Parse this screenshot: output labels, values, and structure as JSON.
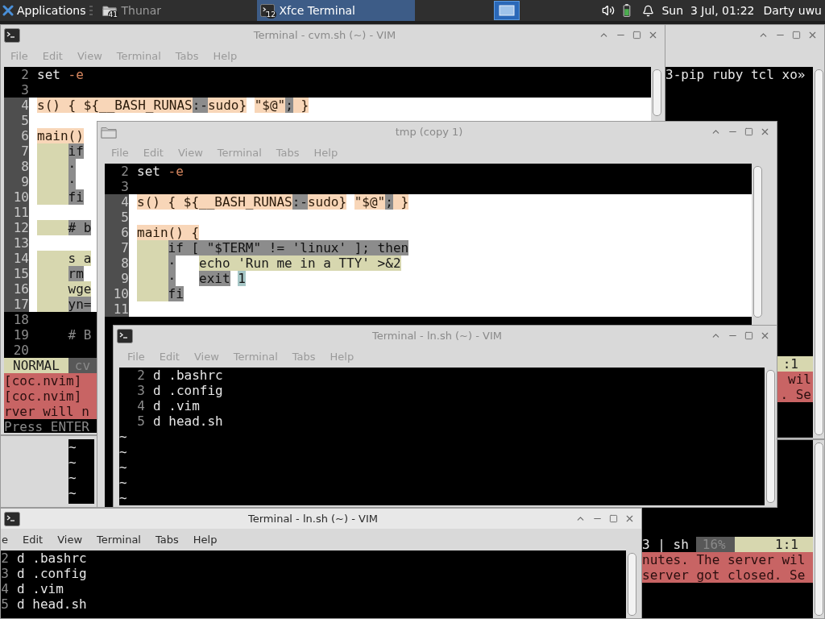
{
  "taskbar": {
    "menu": "Applications",
    "tasks": [
      {
        "label": "Thunar",
        "count": "41",
        "selected": false
      },
      {
        "label": "Xfce Terminal",
        "count": "12",
        "selected": true
      }
    ],
    "clock": "Sun  3 Jul, 01:22",
    "user": "Darty uwu"
  },
  "windows": [
    {
      "lines": [
        {
          "kind": "dark",
          "segments": [
            {
              "text": "3-pip ruby tcl xo»",
              "kind": "plain"
            }
          ]
        }
      ],
      "status": [
        {
          "text": ":1",
          "kind": "olive"
        }
      ],
      "messages": [
        "wil",
        ". Se"
      ]
    },
    {
      "status": [
        {
          "text": "3 | sh",
          "kind": "plain"
        },
        {
          "text": "16%",
          "kind": "muted"
        },
        {
          "text": "1:1",
          "kind": "olive"
        }
      ],
      "messages": [
        "nutes. The server wil",
        "server got closed. Se"
      ]
    },
    {
      "title": "Terminal - cvm.sh (~) - VIM",
      "active": false,
      "menu": [
        "File",
        "Edit",
        "View",
        "Terminal",
        "Tabs",
        "Help"
      ],
      "lines": [
        {
          "num": "2",
          "kind": "dark",
          "segments": [
            {
              "text": "set",
              "kind": "plain"
            },
            {
              "kind": "space"
            },
            {
              "text": "-e",
              "kind": "red"
            }
          ]
        },
        {
          "num": "3",
          "kind": "dark"
        },
        {
          "num": "4",
          "kind": "lit",
          "segments": [
            {
              "text": "s() { ${__BASH_RUNAS",
              "kind": "peach"
            },
            {
              "text": ":-",
              "kind": "gray"
            },
            {
              "text": "sudo}",
              "kind": "peach"
            },
            {
              "kind": "space"
            },
            {
              "text": "\"$@\"",
              "kind": "peach"
            },
            {
              "text": ";",
              "kind": "gray"
            },
            {
              "text": " }",
              "kind": "peach"
            }
          ]
        },
        {
          "num": "5",
          "kind": "lit"
        },
        {
          "num": "6",
          "kind": "lit",
          "segments": [
            {
              "text": "main()",
              "kind": "peach"
            }
          ]
        },
        {
          "num": "7",
          "kind": "lit",
          "segments": [
            {
              "kind": "indent"
            },
            {
              "text": "if",
              "kind": "gray"
            }
          ]
        },
        {
          "num": "8",
          "kind": "lit",
          "segments": [
            {
              "kind": "indent"
            },
            {
              "text": "·",
              "kind": "gray"
            }
          ]
        },
        {
          "num": "9",
          "kind": "lit",
          "segments": [
            {
              "kind": "indent"
            },
            {
              "text": "·",
              "kind": "gray"
            }
          ]
        },
        {
          "num": "10",
          "kind": "lit",
          "segments": [
            {
              "kind": "indent"
            },
            {
              "text": "fi",
              "kind": "gray"
            }
          ]
        },
        {
          "num": "11",
          "kind": "lit"
        },
        {
          "num": "12",
          "kind": "lit",
          "segments": [
            {
              "kind": "indent"
            },
            {
              "text": "# b",
              "kind": "gray"
            }
          ]
        },
        {
          "num": "13",
          "kind": "lit"
        },
        {
          "num": "14",
          "kind": "lit",
          "segments": [
            {
              "kind": "indent"
            },
            {
              "text": "s a",
              "kind": "olive"
            }
          ]
        },
        {
          "num": "15",
          "kind": "lit",
          "segments": [
            {
              "kind": "indent"
            },
            {
              "text": "rm",
              "kind": "gray"
            }
          ]
        },
        {
          "num": "16",
          "kind": "lit",
          "segments": [
            {
              "kind": "indent"
            },
            {
              "text": "wge",
              "kind": "olive"
            }
          ]
        },
        {
          "num": "17",
          "kind": "lit",
          "segments": [
            {
              "kind": "indent"
            },
            {
              "text": "yn=",
              "kind": "gray"
            }
          ]
        },
        {
          "num": "18",
          "kind": "dark"
        },
        {
          "num": "19",
          "kind": "dark",
          "segments": [
            {
              "kind": "blank"
            },
            {
              "text": "# B",
              "kind": "dim"
            }
          ]
        },
        {
          "num": "20",
          "kind": "dark"
        }
      ],
      "status": [
        {
          "text": "NORMAL",
          "kind": "mode"
        },
        {
          "text": "cv",
          "kind": "muted"
        }
      ],
      "messages": [
        "[coc.nvim]",
        "[coc.nvim]",
        "rver will n"
      ],
      "prompt": "Press ENTER"
    },
    {
      "lines": [
        {
          "kind": "dark",
          "segments": [
            {
              "text": "~",
              "kind": "plain"
            }
          ]
        },
        {
          "kind": "dark",
          "segments": [
            {
              "text": "~",
              "kind": "plain"
            }
          ]
        },
        {
          "kind": "dark",
          "segments": [
            {
              "text": "~",
              "kind": "plain"
            }
          ]
        },
        {
          "kind": "dark",
          "segments": [
            {
              "text": "~",
              "kind": "plain"
            }
          ]
        }
      ]
    },
    {
      "title": "tmp (copy 1)",
      "active": false,
      "menu": [
        "File",
        "Edit",
        "View",
        "Terminal",
        "Tabs",
        "Help"
      ],
      "lines": [
        {
          "num": "2",
          "kind": "dark",
          "segments": [
            {
              "text": "set",
              "kind": "plain"
            },
            {
              "kind": "space"
            },
            {
              "text": "-e",
              "kind": "red"
            }
          ]
        },
        {
          "num": "3",
          "kind": "dark"
        },
        {
          "num": "4",
          "kind": "lit",
          "segments": [
            {
              "text": "s() { ${__BASH_RUNAS",
              "kind": "peach"
            },
            {
              "text": ":-",
              "kind": "gray"
            },
            {
              "text": "sudo}",
              "kind": "peach"
            },
            {
              "kind": "space"
            },
            {
              "text": "\"$@\"",
              "kind": "peach"
            },
            {
              "text": ";",
              "kind": "gray"
            },
            {
              "text": " }",
              "kind": "peach"
            }
          ]
        },
        {
          "num": "5",
          "kind": "lit"
        },
        {
          "num": "6",
          "kind": "lit",
          "segments": [
            {
              "text": "main() {",
              "kind": "peach"
            }
          ]
        },
        {
          "num": "7",
          "kind": "lit",
          "segments": [
            {
              "kind": "indent"
            },
            {
              "text": "if [ \"$TERM\" != 'linux' ]; then",
              "kind": "gray"
            }
          ]
        },
        {
          "num": "8",
          "kind": "lit",
          "segments": [
            {
              "kind": "indent"
            },
            {
              "text": "·",
              "kind": "gray"
            },
            {
              "kind": "tab"
            },
            {
              "text": "echo 'Run me in a TTY' >&2",
              "kind": "olive"
            }
          ]
        },
        {
          "num": "9",
          "kind": "lit",
          "segments": [
            {
              "kind": "indent"
            },
            {
              "text": "·",
              "kind": "gray"
            },
            {
              "kind": "tab"
            },
            {
              "text": "exit",
              "kind": "gray"
            },
            {
              "kind": "space"
            },
            {
              "text": "1",
              "kind": "teal"
            }
          ]
        },
        {
          "num": "10",
          "kind": "lit",
          "segments": [
            {
              "kind": "indent"
            },
            {
              "text": "fi",
              "kind": "gray"
            }
          ]
        },
        {
          "num": "11",
          "kind": "lit"
        }
      ]
    },
    {
      "title": "Terminal - ln.sh (~) - VIM",
      "active": false,
      "menu": [
        "File",
        "Edit",
        "View",
        "Terminal",
        "Tabs",
        "Help"
      ],
      "lines": [
        {
          "num": "2",
          "kind": "dark",
          "segments": [
            {
              "text": "d .bashrc",
              "kind": "plain"
            }
          ]
        },
        {
          "num": "3",
          "kind": "dark",
          "segments": [
            {
              "text": "d .config",
              "kind": "plain"
            }
          ]
        },
        {
          "num": "4",
          "kind": "dark",
          "segments": [
            {
              "text": "d .vim",
              "kind": "plain"
            }
          ]
        },
        {
          "num": "5",
          "kind": "dark",
          "segments": [
            {
              "text": "d head.sh",
              "kind": "plain"
            }
          ]
        },
        {
          "kind": "dark",
          "segments": [
            {
              "text": "~",
              "kind": "plain"
            }
          ]
        },
        {
          "kind": "dark",
          "segments": [
            {
              "text": "~",
              "kind": "plain"
            }
          ]
        },
        {
          "kind": "dark",
          "segments": [
            {
              "text": "~",
              "kind": "plain"
            }
          ]
        },
        {
          "kind": "dark",
          "segments": [
            {
              "text": "~",
              "kind": "plain"
            }
          ]
        },
        {
          "kind": "dark",
          "segments": [
            {
              "text": "~",
              "kind": "plain"
            }
          ]
        }
      ]
    },
    {
      "title": "Terminal - ln.sh (~) - VIM",
      "active": true,
      "menu": [
        "e",
        "Edit",
        "View",
        "Terminal",
        "Tabs",
        "Help"
      ],
      "lines": [
        {
          "num": "2",
          "kind": "dark",
          "segments": [
            {
              "text": "d .bashrc",
              "kind": "plain"
            }
          ]
        },
        {
          "num": "3",
          "kind": "dark",
          "segments": [
            {
              "text": "d .config",
              "kind": "plain"
            }
          ]
        },
        {
          "num": "4",
          "kind": "dark",
          "segments": [
            {
              "text": "d .vim",
              "kind": "plain"
            }
          ]
        },
        {
          "num": "5",
          "kind": "dark",
          "segments": [
            {
              "text": "d head.sh",
              "kind": "plain"
            }
          ]
        }
      ]
    }
  ]
}
